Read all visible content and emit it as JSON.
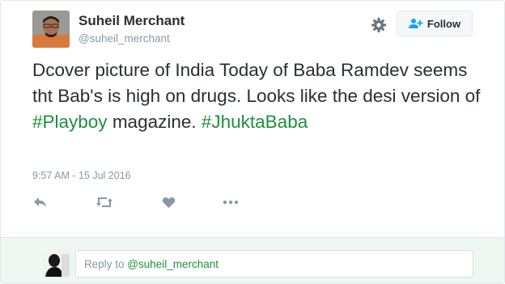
{
  "author": {
    "name": "Suheil Merchant",
    "handle": "@suheil_merchant"
  },
  "header": {
    "settings_icon": "gear-icon",
    "follow_label": "Follow",
    "follow_icon": "add-person-icon"
  },
  "tweet": {
    "text_part1": "Dcover picture of India Today of Baba Ramdev seems tht Bab's is high on drugs. Looks like the desi version of ",
    "hashtag1": "#Playboy",
    "text_part2": " magazine. ",
    "hashtag2": "#JhuktaBaba",
    "timestamp": "9:57 AM - 15 Jul 2016"
  },
  "actions": [
    {
      "icon": "reply-icon"
    },
    {
      "icon": "retweet-icon"
    },
    {
      "icon": "heart-icon"
    },
    {
      "icon": "more-icon"
    }
  ],
  "reply_box": {
    "prefix": "Reply to ",
    "handle": "@suheil_merchant"
  },
  "colors": {
    "accent": "#1e8f3b",
    "muted": "#8899a6",
    "text": "#292f33",
    "reply_bar_bg": "#eef7f1"
  }
}
